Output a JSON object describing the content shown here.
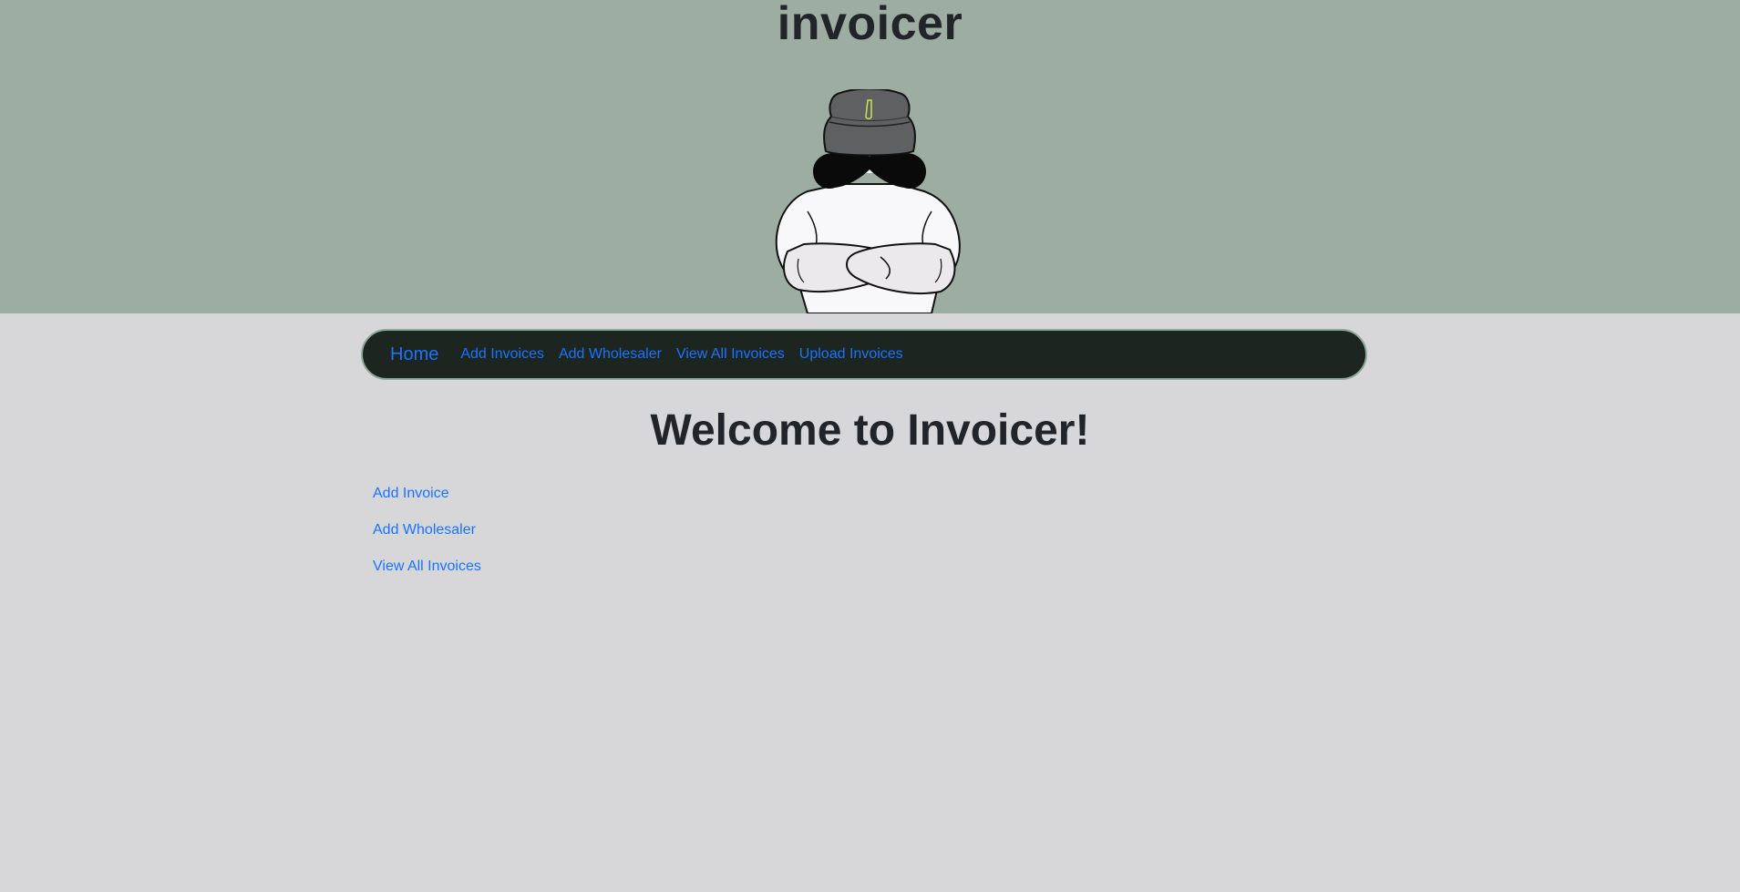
{
  "header": {
    "title": "invoicer",
    "mascot_icon": "mustached-mascot-logo",
    "background_color": "#9eada2"
  },
  "navbar": {
    "brand": "Home",
    "links": [
      "Add Invoices",
      "Add Wholesaler",
      "View All Invoices",
      "Upload Invoices"
    ],
    "background_color": "#1c2520",
    "link_color": "#1a73ff"
  },
  "main": {
    "heading": "Welcome to Invoicer!",
    "links": [
      "Add Invoice",
      "Add Wholesaler",
      "View All Invoices"
    ]
  }
}
